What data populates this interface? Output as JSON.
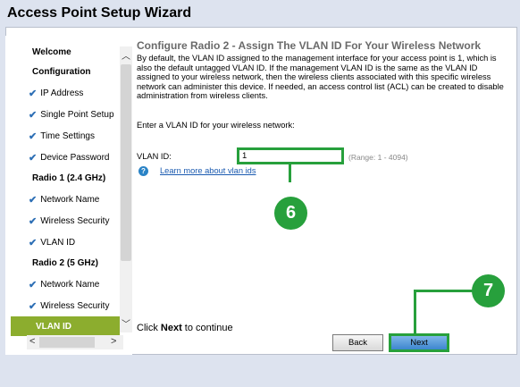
{
  "window": {
    "title": "Access Point Setup Wizard"
  },
  "sidebar": {
    "items": [
      {
        "label": "Welcome",
        "kind": "section"
      },
      {
        "label": "Configuration",
        "kind": "section"
      },
      {
        "label": "IP Address",
        "kind": "step"
      },
      {
        "label": "Single Point Setup",
        "kind": "step"
      },
      {
        "label": "Time Settings",
        "kind": "step"
      },
      {
        "label": "Device Password",
        "kind": "step"
      },
      {
        "label": "Radio 1 (2.4 GHz)",
        "kind": "section"
      },
      {
        "label": "Network Name",
        "kind": "step"
      },
      {
        "label": "Wireless Security",
        "kind": "step"
      },
      {
        "label": "VLAN ID",
        "kind": "step"
      },
      {
        "label": "Radio 2 (5 GHz)",
        "kind": "section"
      },
      {
        "label": "Network Name",
        "kind": "step"
      },
      {
        "label": "Wireless Security",
        "kind": "step"
      },
      {
        "label": "VLAN ID",
        "kind": "active"
      }
    ],
    "check_glyph": "✔",
    "scroll_up_glyph": "︿",
    "scroll_down_glyph": "﹀",
    "scroll_left_glyph": "<",
    "scroll_right_glyph": ">"
  },
  "main": {
    "heading": "Configure Radio 2 - Assign The VLAN ID For Your Wireless Network",
    "description": "By default, the VLAN ID assigned to the management interface for your access point is 1, which is also the default untagged VLAN ID. If the management VLAN ID is the same as the VLAN ID assigned to your wireless network, then the wireless clients associated with this specific wireless network can administer this device. If needed, an access control list (ACL) can be created to disable administration from wireless clients.",
    "prompt": "Enter a VLAN ID for your wireless network:",
    "vlan_label": "VLAN ID:",
    "vlan_value": "1",
    "range_hint": "(Range: 1 - 4094)",
    "help_glyph": "?",
    "learn_more": "Learn more about vlan ids",
    "continue_prefix": "Click ",
    "continue_bold": "Next",
    "continue_suffix": " to continue"
  },
  "buttons": {
    "back": "Back",
    "next": "Next"
  },
  "callouts": {
    "six": "6",
    "seven": "7"
  },
  "colors": {
    "highlight": "#27a03c",
    "active_nav": "#8cad2e",
    "link": "#1a5ab0"
  }
}
